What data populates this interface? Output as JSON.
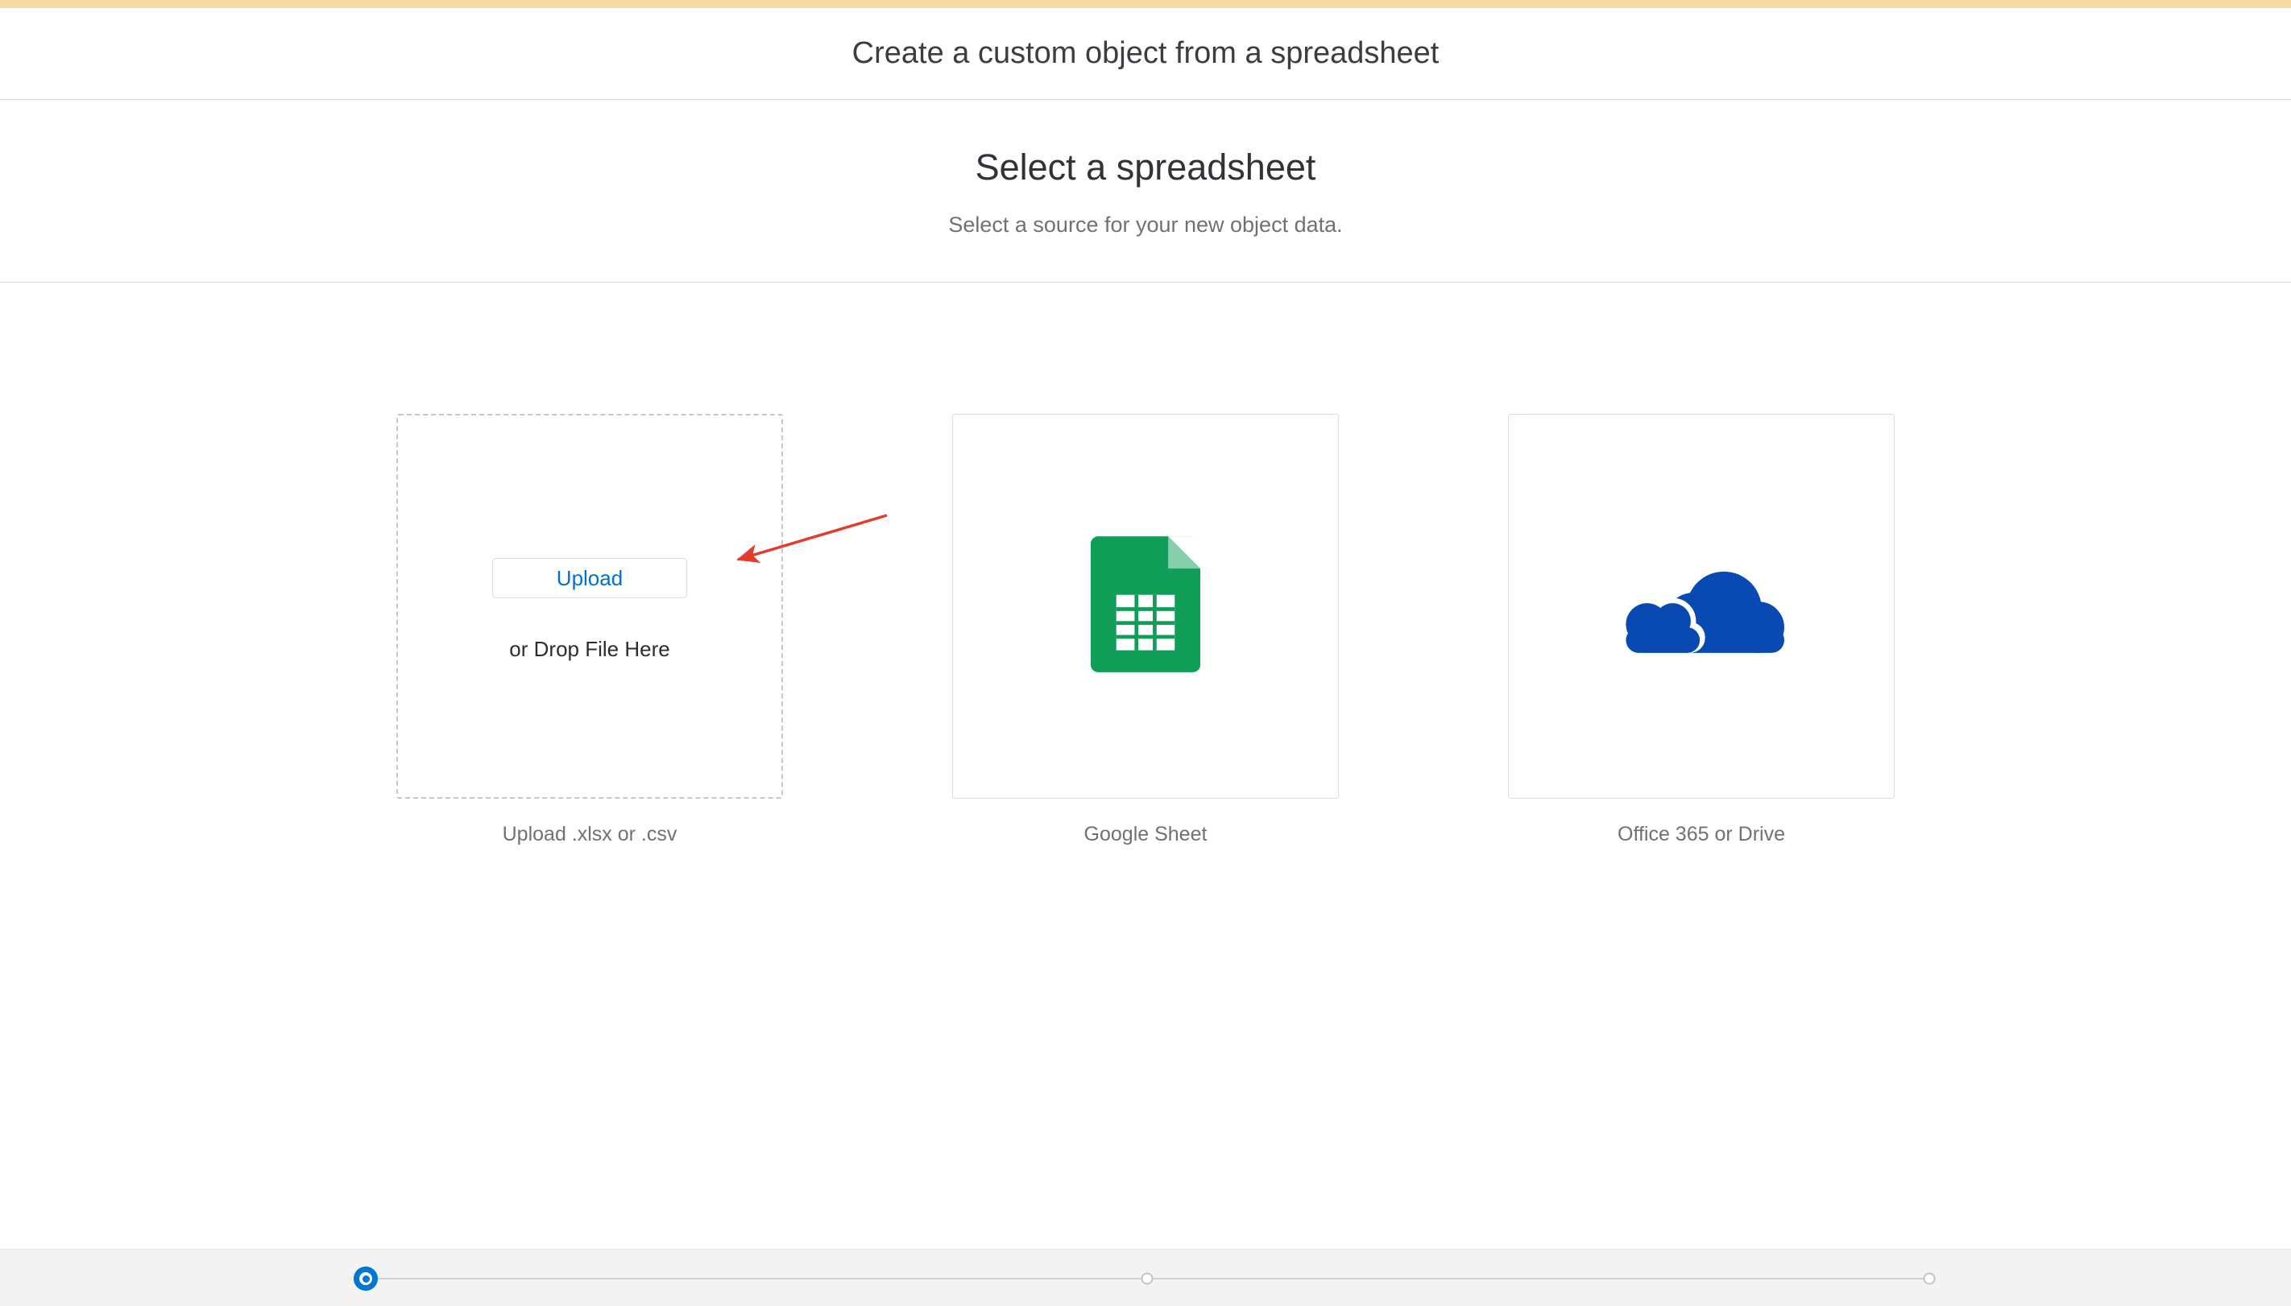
{
  "header": {
    "title": "Create a custom object from a spreadsheet"
  },
  "intro": {
    "title": "Select a spreadsheet",
    "subtitle": "Select a source for your new object data."
  },
  "sources": {
    "upload": {
      "button": "Upload",
      "drop_hint": "or Drop File Here",
      "caption": "Upload .xlsx or .csv"
    },
    "google_sheet": {
      "caption": "Google Sheet"
    },
    "office": {
      "caption": "Office 365 or Drive"
    }
  },
  "progress": {
    "total_steps": 3,
    "current_step": 1
  },
  "icons": {
    "google_sheet": "google-sheets-icon",
    "office": "onedrive-cloud-icon",
    "annotation": "red-arrow-icon"
  },
  "colors": {
    "brand_strip": "#f7d9a1",
    "link_blue": "#0070d2",
    "progress_blue": "#0176d3",
    "sheets_green": "#0f9d58",
    "sheets_fold": "#87ceac",
    "onedrive_blue": "#094ab2",
    "arrow_red": "#e23c2a"
  }
}
